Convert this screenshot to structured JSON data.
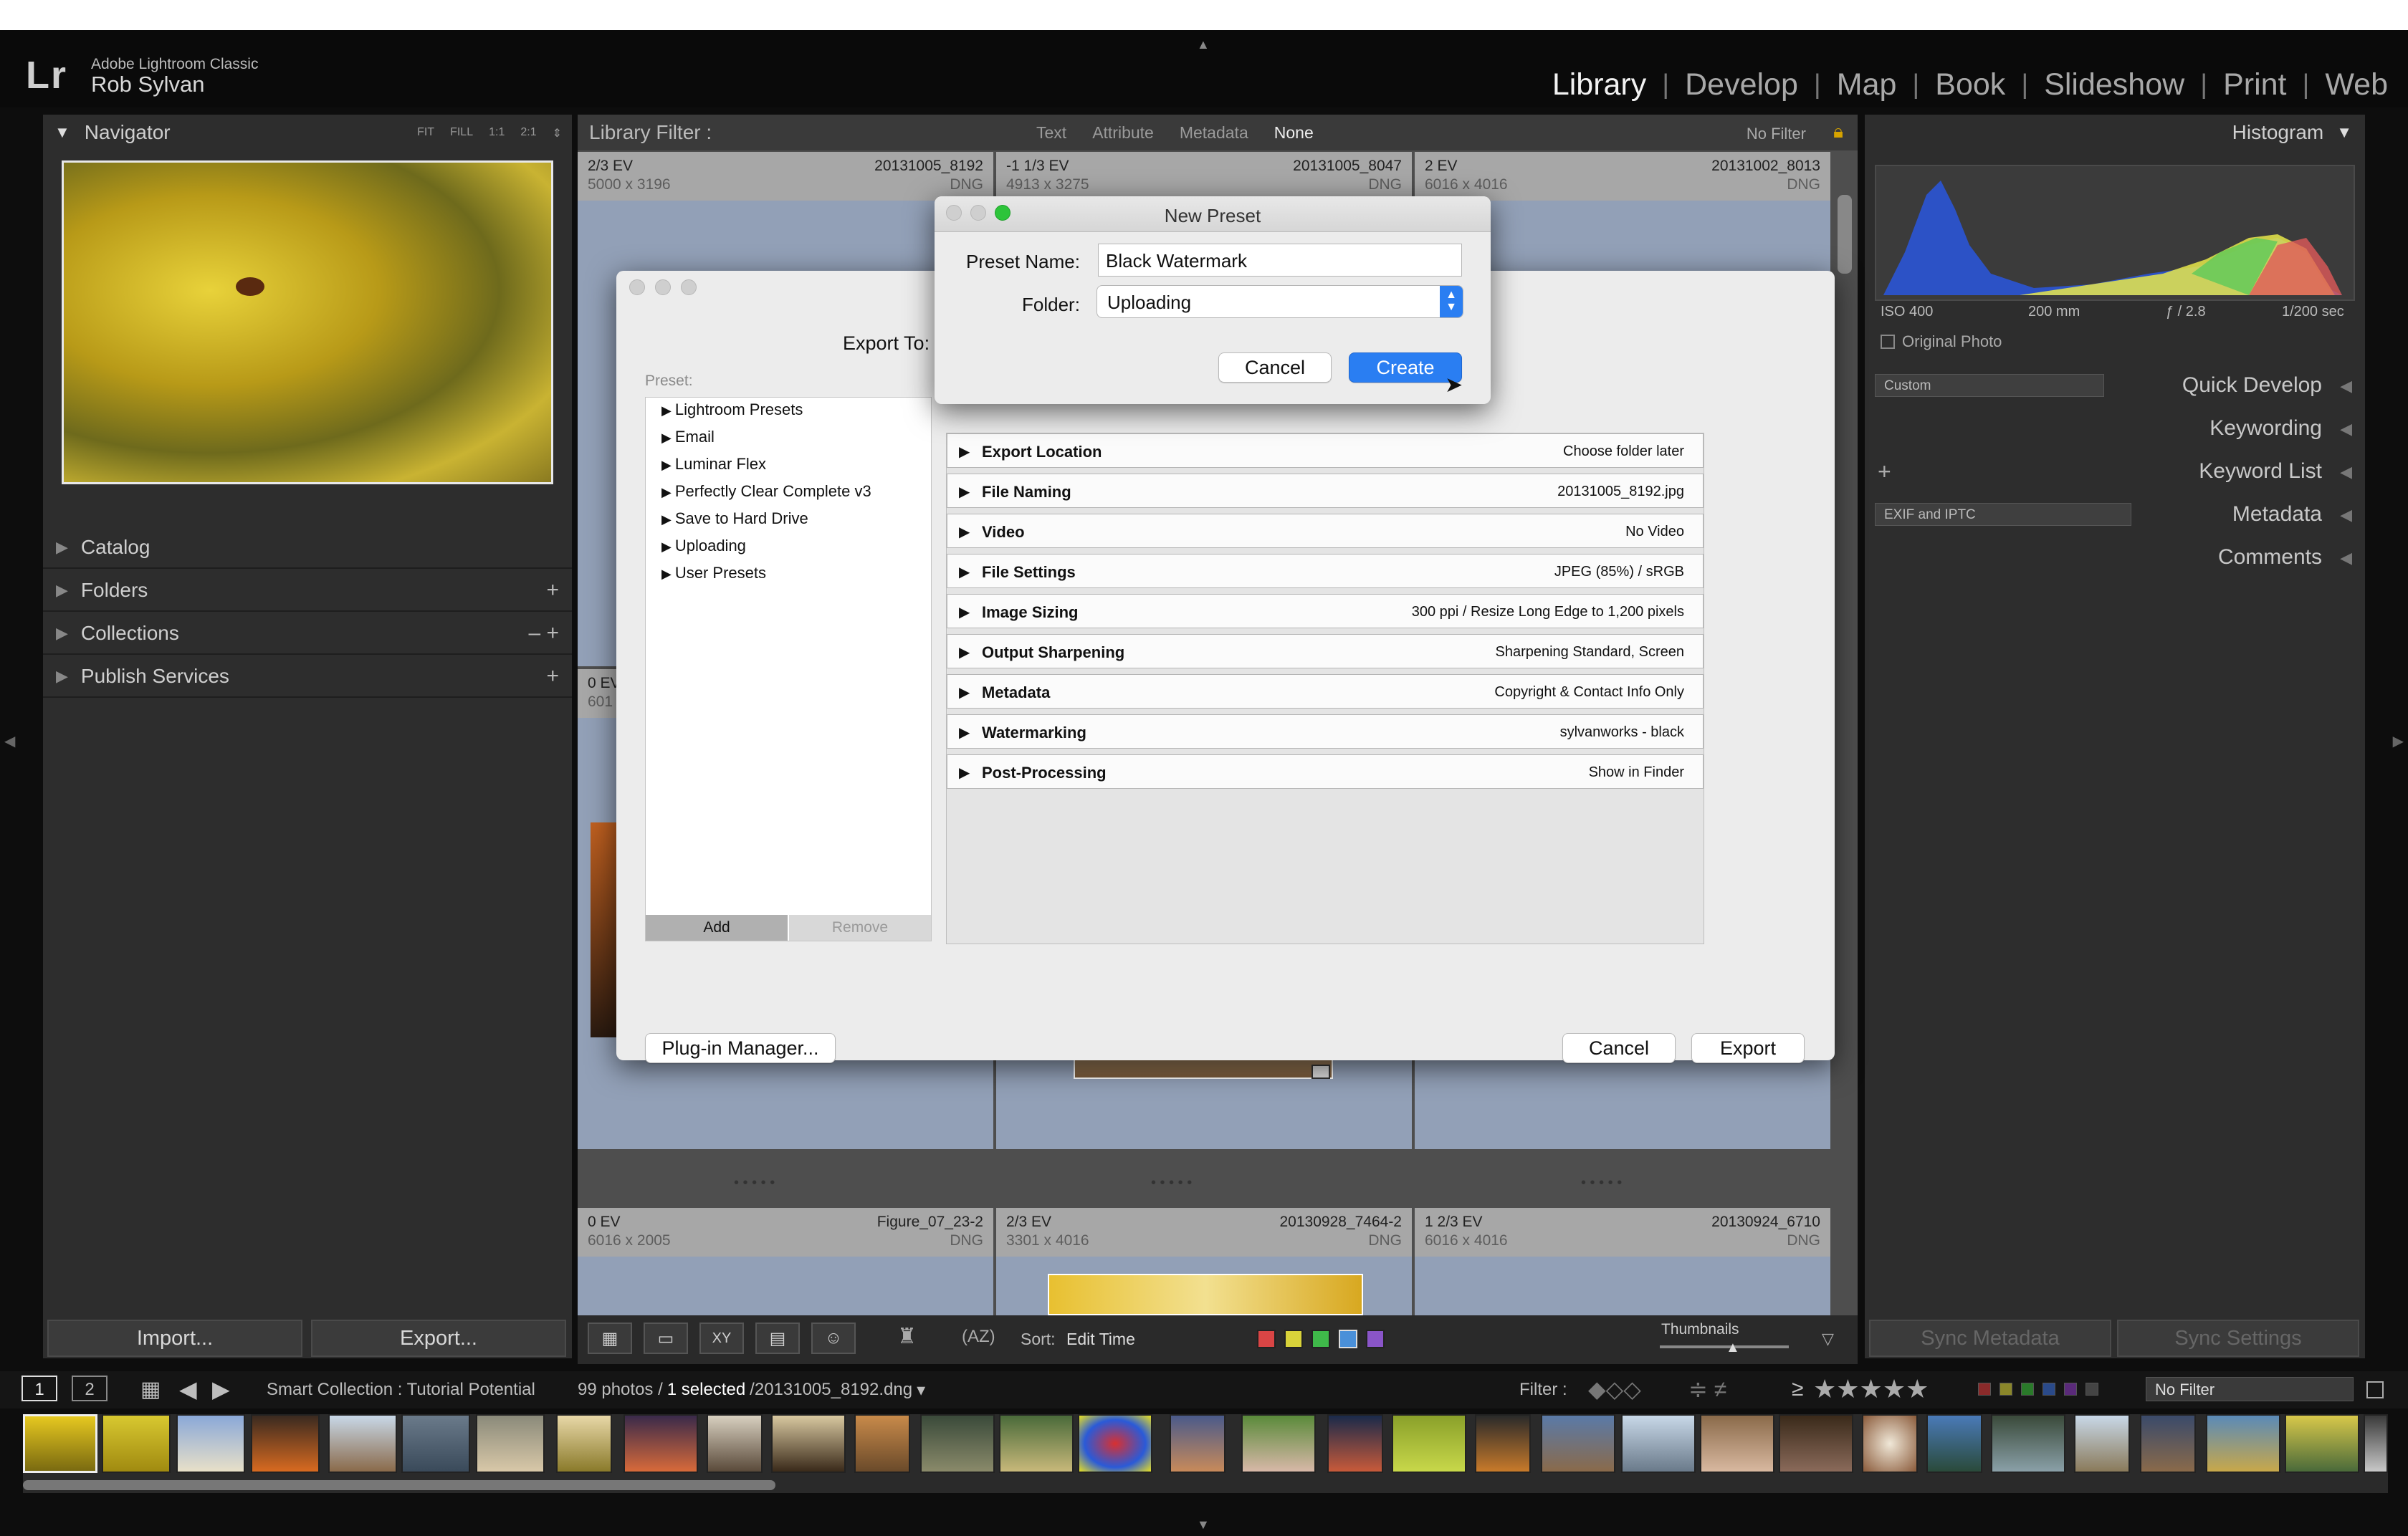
{
  "header": {
    "app_name": "Adobe Lightroom Classic",
    "user_name": "Rob Sylvan",
    "logo": "Lr",
    "modules": [
      "Library",
      "Develop",
      "Map",
      "Book",
      "Slideshow",
      "Print",
      "Web"
    ],
    "active_module": "Library"
  },
  "left_panel": {
    "navigator": {
      "title": "Navigator",
      "zoom": [
        "FIT",
        "FILL",
        "1:1",
        "2:1"
      ]
    },
    "sections": [
      {
        "label": "Catalog",
        "action": ""
      },
      {
        "label": "Folders",
        "action": "+"
      },
      {
        "label": "Collections",
        "action": "– +"
      },
      {
        "label": "Publish Services",
        "action": "+"
      }
    ],
    "import_label": "Import...",
    "export_label": "Export..."
  },
  "library_filter": {
    "title": "Library Filter :",
    "options": [
      "Text",
      "Attribute",
      "Metadata",
      "None"
    ],
    "preset": "No Filter"
  },
  "grid": {
    "cells": [
      {
        "ev": "2/3 EV",
        "file": "20131005_8192",
        "dims": "5000 x 3196",
        "ext": "DNG"
      },
      {
        "ev": "-1 1/3 EV",
        "file": "20131005_8047",
        "dims": "4913 x 3275",
        "ext": "DNG"
      },
      {
        "ev": "2 EV",
        "file": "20131002_8013",
        "dims": "6016 x 4016",
        "ext": "DNG"
      },
      {
        "ev": "0 EV",
        "file": "Figure_07_23-2",
        "dims": "6016 x 2005",
        "ext": "DNG"
      },
      {
        "ev": "2/3 EV",
        "file": "20130928_7464-2",
        "dims": "3301 x 4016",
        "ext": "DNG"
      },
      {
        "ev": "1 2/3 EV",
        "file": "20130924_6710",
        "dims": "6016 x 4016",
        "ext": "DNG"
      }
    ],
    "partial_labels": [
      "0 EV",
      "601"
    ],
    "dots": "• • • • •"
  },
  "export_dialog": {
    "export_to_label": "Export To:",
    "preset_label": "Preset:",
    "presets": [
      "Lightroom Presets",
      "Email",
      "Luminar Flex",
      "Perfectly Clear Complete v3",
      "Save to Hard Drive",
      "Uploading",
      "User Presets"
    ],
    "add_label": "Add",
    "remove_label": "Remove",
    "sections": [
      {
        "title": "Export Location",
        "value": "Choose folder later"
      },
      {
        "title": "File Naming",
        "value": "20131005_8192.jpg"
      },
      {
        "title": "Video",
        "value": "No Video"
      },
      {
        "title": "File Settings",
        "value": "JPEG (85%) / sRGB"
      },
      {
        "title": "Image Sizing",
        "value": "300 ppi / Resize Long Edge to 1,200 pixels"
      },
      {
        "title": "Output Sharpening",
        "value": "Sharpening Standard, Screen"
      },
      {
        "title": "Metadata",
        "value": "Copyright & Contact Info Only"
      },
      {
        "title": "Watermarking",
        "value": "sylvanworks - black"
      },
      {
        "title": "Post-Processing",
        "value": "Show in Finder"
      }
    ],
    "plugin_manager_label": "Plug-in Manager...",
    "cancel_label": "Cancel",
    "export_label": "Export"
  },
  "new_preset_dialog": {
    "title": "New Preset",
    "name_label": "Preset Name:",
    "name_value": "Black Watermark",
    "folder_label": "Folder:",
    "folder_value": "Uploading",
    "cancel_label": "Cancel",
    "create_label": "Create"
  },
  "right_panel": {
    "histogram_title": "Histogram",
    "iso": "ISO 400",
    "focal": "200 mm",
    "aperture": "ƒ / 2.8",
    "shutter": "1/200 sec",
    "original_photo_label": "Original Photo",
    "quick_develop_preset": "Custom",
    "panels": [
      "Quick Develop",
      "Keywording",
      "Keyword List",
      "Metadata",
      "Comments"
    ],
    "metadata_preset": "EXIF and IPTC",
    "sync_metadata_label": "Sync Metadata",
    "sync_settings_label": "Sync Settings"
  },
  "toolbar": {
    "sort_label": "Sort:",
    "sort_value": "Edit Time",
    "thumbnails_label": "Thumbnails",
    "color_labels": [
      "#d94545",
      "#d8d23a",
      "#3fb94a",
      "#4a90d9",
      "#8a55c8"
    ]
  },
  "filmstrip_bar": {
    "screens": [
      "1",
      "2"
    ],
    "source": "Smart Collection : Tutorial Potential",
    "count": "99 photos /",
    "selected": "1 selected",
    "filename": "/20131005_8192.dng",
    "filter_label": "Filter :",
    "rating_op": "≥",
    "stars": "★★★★★",
    "filter_preset": "No Filter"
  }
}
